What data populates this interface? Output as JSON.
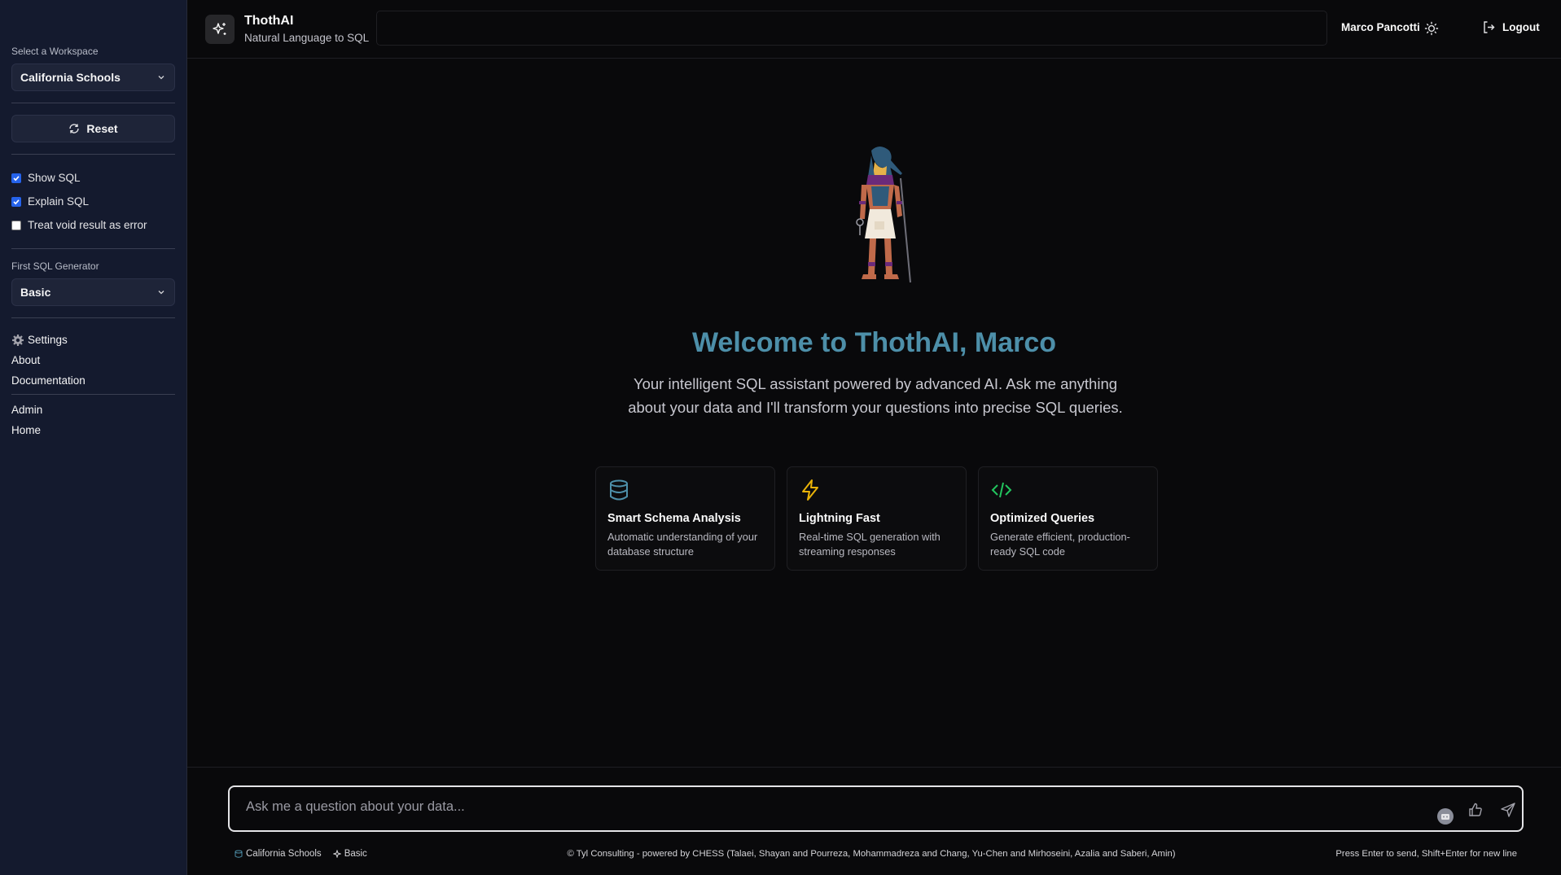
{
  "sidebar": {
    "workspace_label": "Select a Workspace",
    "workspace_value": "California Schools",
    "reset_label": "Reset",
    "options": [
      {
        "label": "Show SQL",
        "checked": true
      },
      {
        "label": "Explain SQL",
        "checked": true
      },
      {
        "label": "Treat void result as error",
        "checked": false
      }
    ],
    "generator_label": "First SQL Generator",
    "generator_value": "Basic",
    "nav": {
      "settings": "Settings",
      "about": "About",
      "documentation": "Documentation",
      "admin": "Admin",
      "home": "Home"
    }
  },
  "header": {
    "title": "ThothAI",
    "subtitle": "Natural Language to SQL",
    "user_name": "Marco Pancotti",
    "logout_label": "Logout"
  },
  "main": {
    "welcome": "Welcome to ThothAI, Marco",
    "intro": "Your intelligent SQL assistant powered by advanced AI. Ask me anything about your data and I'll transform your questions into precise SQL queries.",
    "cards": [
      {
        "icon": "database-icon",
        "color": "#4d8fa9",
        "title": "Smart Schema Analysis",
        "desc": "Automatic understanding of your database structure"
      },
      {
        "icon": "zap-icon",
        "color": "#eab308",
        "title": "Lightning Fast",
        "desc": "Real-time SQL generation with streaming responses"
      },
      {
        "icon": "code-icon",
        "color": "#22c55e",
        "title": "Optimized Queries",
        "desc": "Generate efficient, production-ready SQL code"
      }
    ]
  },
  "chat": {
    "placeholder": "Ask me a question about your data..."
  },
  "footer": {
    "workspace": "California Schools",
    "generator": "Basic",
    "credits": "© Tyl Consulting - powered by CHESS (Talaei, Shayan and Pourreza, Mohammadreza and Chang, Yu-Chen and Mirhoseini, Azalia and Saberi, Amin)",
    "hint": "Press Enter to send, Shift+Enter for new line"
  },
  "colors": {
    "sidebar_bg": "#141a2e",
    "main_bg": "#09090b",
    "accent": "#4d8fa9",
    "checkbox": "#2563eb"
  }
}
